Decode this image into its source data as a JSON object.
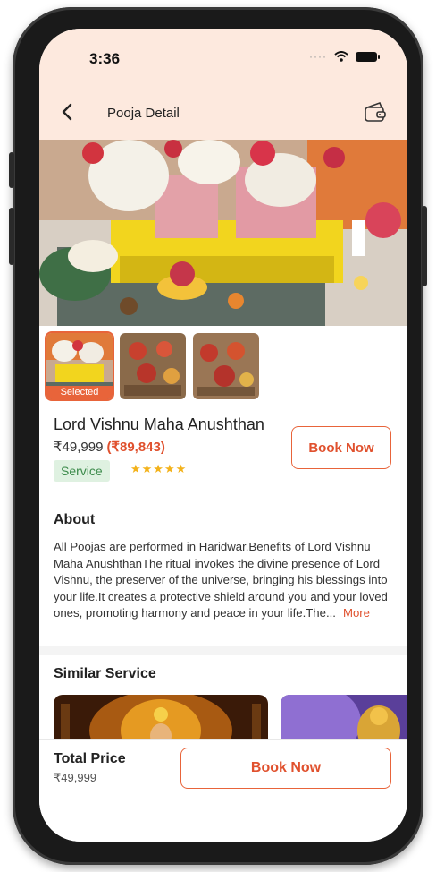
{
  "status_bar": {
    "time": "3:36",
    "signal_dots": "····"
  },
  "header": {
    "title": "Pooja Detail"
  },
  "gallery": {
    "selected_tag": "Selected"
  },
  "service": {
    "title": "Lord Vishnu Maha Anushthan",
    "price": "₹49,999",
    "original_price": "(₹89,843)",
    "badge": "Service",
    "rating_stars": "★★★★★",
    "book_label": "Book Now"
  },
  "about": {
    "heading": "About",
    "text": "All Poojas are performed in Haridwar.Benefits of Lord Vishnu Maha AnushthanThe ritual invokes the divine presence of Lord Vishnu, the preserver of the universe, bringing his blessings into your life.It creates a protective shield around you and your loved ones, promoting harmony and peace in your life.The...",
    "more_label": "More"
  },
  "similar": {
    "heading": "Similar Service"
  },
  "footer": {
    "total_label": "Total Price",
    "total_value": "₹49,999",
    "book_label": "Book Now"
  },
  "colors": {
    "accent": "#e8643a",
    "header_bg": "#fde9de",
    "badge_bg": "#dff1e1",
    "star": "#f3b21b"
  }
}
